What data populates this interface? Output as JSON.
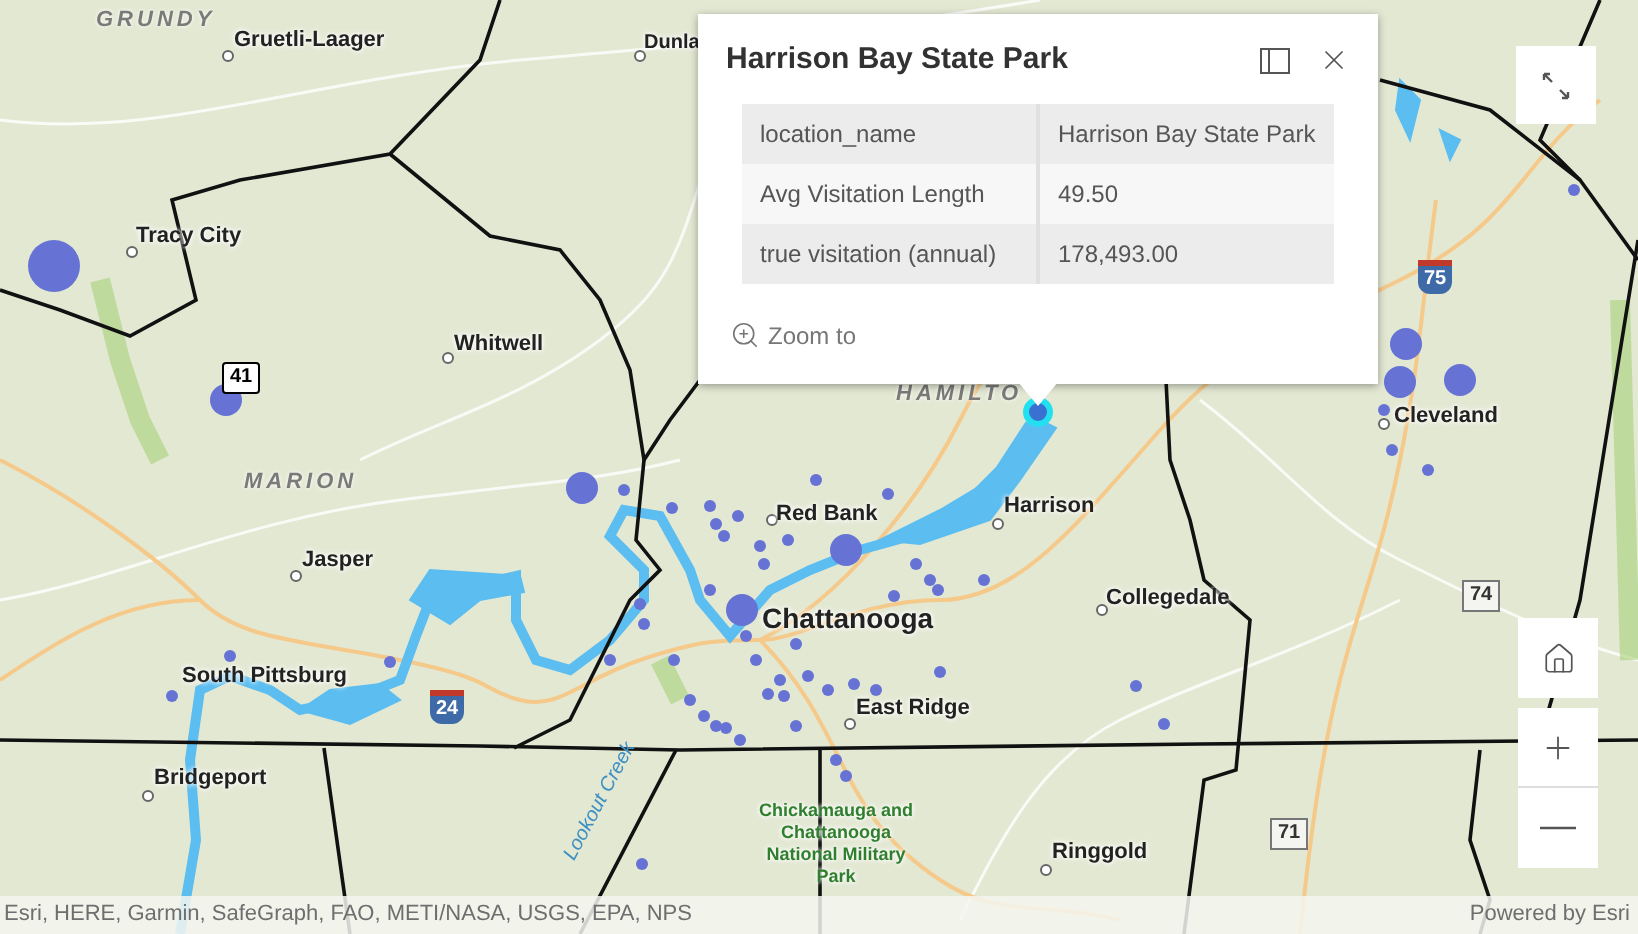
{
  "map": {
    "region_labels": [
      "GRUNDY",
      "MARION",
      "HAMILTO"
    ],
    "place_labels": [
      "Gruetli-Laager",
      "Dunla",
      "Tracy City",
      "Whitwell",
      "Jasper",
      "South Pittsburg",
      "Bridgeport",
      "Red Bank",
      "Chattanooga",
      "Harrison",
      "Collegedale",
      "East Ridge",
      "Ringgold",
      "Cleveland"
    ],
    "route_shields": [
      {
        "kind": "us",
        "label": "41"
      },
      {
        "kind": "interstate",
        "label": "24"
      },
      {
        "kind": "interstate",
        "label": "75"
      },
      {
        "kind": "state",
        "label": "74"
      },
      {
        "kind": "state",
        "label": "71"
      }
    ],
    "water_labels": [
      "Lookout Creek"
    ],
    "park_labels": [
      "Chickamauga and Chattanooga National Military Park"
    ]
  },
  "popup": {
    "title": "Harrison Bay State Park",
    "fields": [
      {
        "label": "location_name",
        "value": "Harrison Bay State Park"
      },
      {
        "label": "Avg Visitation Length",
        "value": "49.50"
      },
      {
        "label": "true visitation (annual)",
        "value": "178,493.00"
      }
    ],
    "action": "Zoom to"
  },
  "attribution": {
    "sources": "Esri, HERE, Garmin, SafeGraph, FAO, METI/NASA, USGS, EPA, NPS",
    "powered_by": "Powered by Esri"
  }
}
